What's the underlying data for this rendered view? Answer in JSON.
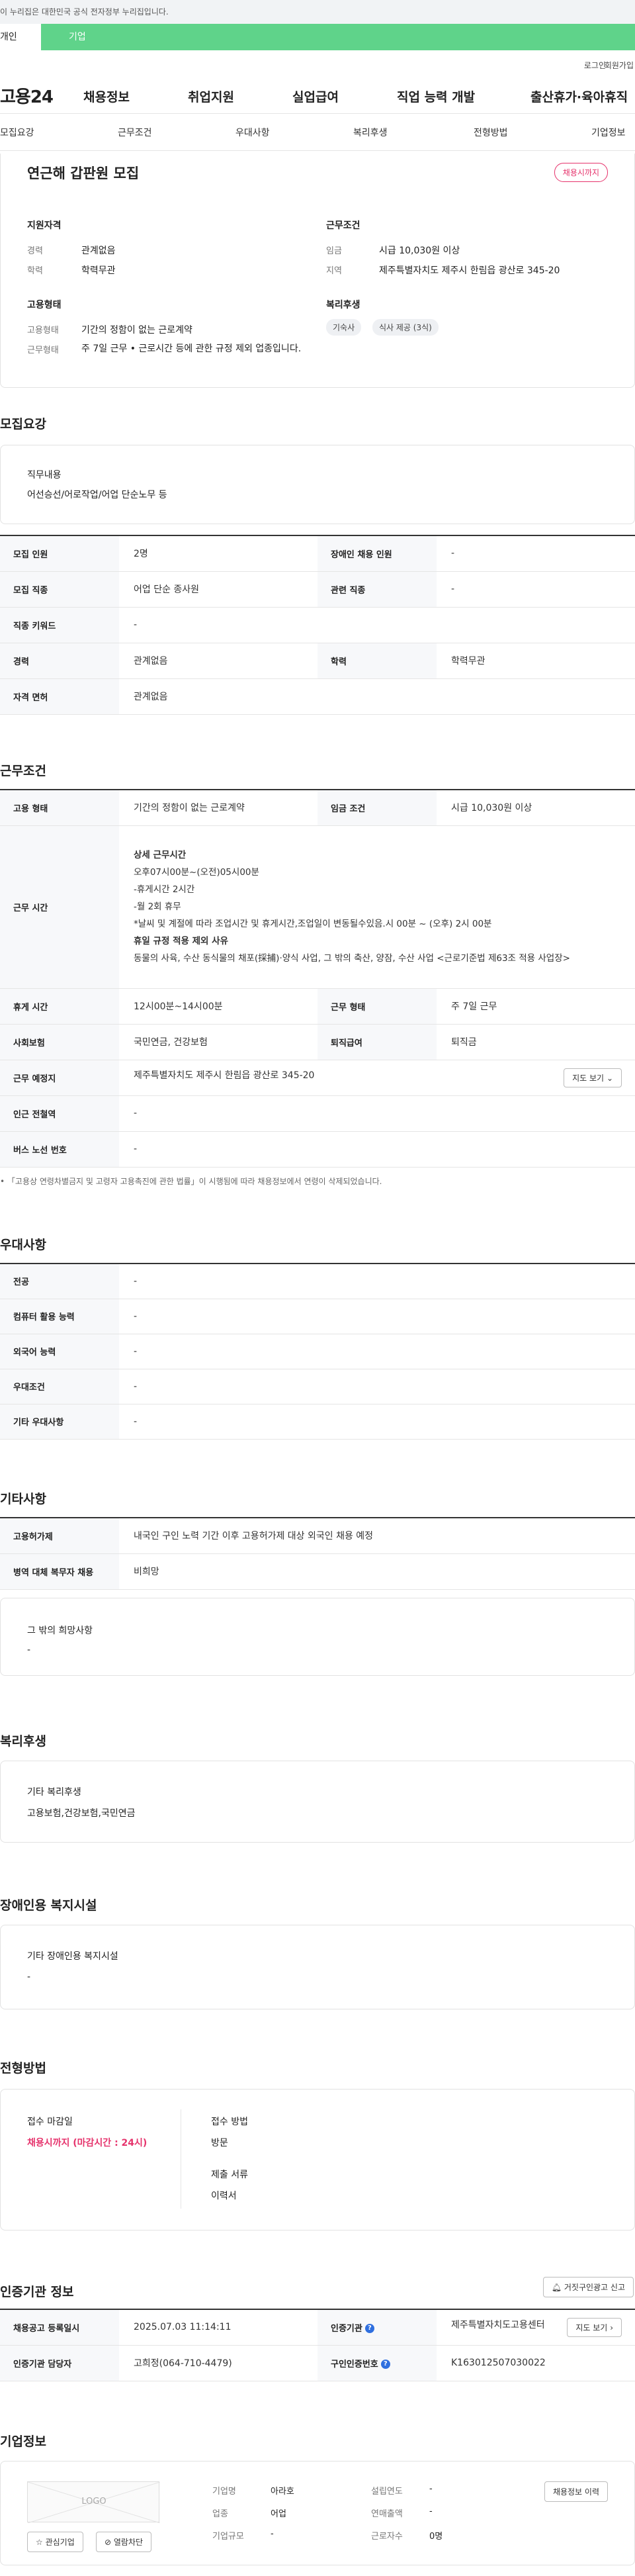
{
  "gov_bar": "이 누리집은 대한민국 공식 전자정부 누리집입니다.",
  "user_tabs": [
    "개인",
    "기업"
  ],
  "util": {
    "login": "로그인",
    "join": "회원가입"
  },
  "logo": "고용24",
  "gnb": [
    "채용정보",
    "취업지원",
    "실업급여",
    "직업 능력 개발",
    "출산휴가·육아휴직"
  ],
  "snb": [
    "모집요강",
    "근무조건",
    "우대사항",
    "복리후생",
    "전형방법",
    "기업정보"
  ],
  "summary": {
    "title": "연근해 갑판원 모집",
    "status": "채용시까지",
    "qual_head": "지원자격",
    "career_label": "경력",
    "career_value": "관계없음",
    "edu_label": "학력",
    "edu_value": "학력무관",
    "cond_head": "근무조건",
    "wage_label": "임금",
    "wage_value": "시급 10,030원 이상",
    "region_label": "지역",
    "region_value": "제주특별자치도 제주시 한림읍 광산로 345-20",
    "emp_head": "고용형태",
    "emptype_label": "고용형태",
    "emptype_value": "기간의 정함이 없는 근로계약",
    "worktype_label": "근무형태",
    "worktype_value": "주 7일 근무 • 근로시간 등에 관한 규정 제외 업종입니다.",
    "welfare_head": "복리후생",
    "chips": [
      "기숙사",
      "식사 제공 (3식)"
    ]
  },
  "recruit": {
    "title": "모집요강",
    "duty_head": "직무내용",
    "duty_value": "어선승선/어로작업/어업 단순노무 등",
    "rows": [
      [
        "모집 인원",
        "2명",
        "장애인 채용 인원",
        "-"
      ],
      [
        "모집 직종",
        "어업 단순 종사원",
        "관련 직종",
        "-"
      ],
      [
        "직종 키워드",
        "-"
      ],
      [
        "경력",
        "관계없음",
        "학력",
        "학력무관"
      ],
      [
        "자격 면허",
        "관계없음"
      ]
    ]
  },
  "work": {
    "title": "근무조건",
    "emptype_th": "고용 형태",
    "emptype_td": "기간의 정함이 없는 근로계약",
    "wage_th": "임금 조건",
    "wage_td": "시급 10,030원 이상",
    "hours_th": "근무 시간",
    "hours_lines": [
      "상세 근무시간",
      "오후07시00분~(오전)05시00분",
      "-휴게시간 2시간",
      "-월 2회 휴무",
      "*날씨 및 계절에 따라 조업시간 및 휴게시간,조업일이 변동될수있음.시 00분 ~ (오후) 2시 00분",
      "휴일 규정 적용 제외 사유",
      "동물의 사육, 수산 동식물의 채포(採捕)·양식 사업, 그 밖의 축산, 양잠, 수산 사업 <근로기준법 제63조 적용 사업장>"
    ],
    "break_th": "휴게 시간",
    "break_td": "12시00분~14시00분",
    "worktype_th": "근무 형태",
    "worktype_td": "주 7일 근무",
    "ins_th": "사회보험",
    "ins_td": "국민연금, 건강보험",
    "retire_th": "퇴직급여",
    "retire_td": "퇴직금",
    "place_th": "근무 예정지",
    "place_td": "제주특별자치도 제주시 한림읍 광산로 345-20",
    "map_btn": "지도 보기",
    "subway_th": "인근 전철역",
    "subway_td": "-",
    "bus_th": "버스 노선 번호",
    "bus_td": "-",
    "note": "「고용상 연령차별금지 및 고령자 고용촉진에 관한 법률」이 시행됨에 따라 채용정보에서 연령이 삭제되었습니다."
  },
  "pref": {
    "title": "우대사항",
    "rows": [
      [
        "전공",
        "-"
      ],
      [
        "컴퓨터 활용 능력",
        "-"
      ],
      [
        "외국어 능력",
        "-"
      ],
      [
        "우대조건",
        "-"
      ],
      [
        "기타 우대사항",
        "-"
      ]
    ]
  },
  "etc": {
    "title": "기타사항",
    "rows": [
      [
        "고용허가제",
        "내국인 구인 노력 기간 이후 고용허가제 대상 외국인 채용 예정"
      ],
      [
        "병역 대체 복무자 채용",
        "비희망"
      ]
    ],
    "wish_head": "그 밖의 희망사항",
    "wish_value": "-"
  },
  "welfare": {
    "title": "복리후생",
    "head": "기타 복리후생",
    "value": "고용보험,건강보험,국민연금"
  },
  "disabled": {
    "title": "장애인용 복지시설",
    "head": "기타 장애인용 복지시설",
    "value": "-"
  },
  "process": {
    "title": "전형방법",
    "deadline_head": "접수 마감일",
    "deadline_value": "채용시까지 (마감시간 : 24시)",
    "method_head": "접수 방법",
    "method_value": "방문",
    "docs_head": "제출 서류",
    "docs_value": "이력서"
  },
  "agency": {
    "title": "인증기관 정보",
    "report_btn": "거짓구인광고 신고",
    "reg_th": "채용공고 등록일시",
    "reg_td": "2025.07.03 11:14:11",
    "org_th": "인증기관",
    "org_td": "제주특별자치도고용센터",
    "map_btn": "지도 보기",
    "mgr_th": "인증기관 담당자",
    "mgr_td": "고희정(064-710-4479)",
    "no_th": "구인인증번호",
    "no_td": "K163012507030022"
  },
  "company": {
    "title": "기업정보",
    "logo_text": "LOGO",
    "interest_btn": "관심기업",
    "block_btn": "열람차단",
    "history_btn": "채용정보 이력",
    "name_l": "기업명",
    "name_v": "아라호",
    "found_l": "설립연도",
    "found_v": "-",
    "ind_l": "업종",
    "ind_v": "어업",
    "sales_l": "연매출액",
    "sales_v": "-",
    "size_l": "기업규모",
    "size_v": "-",
    "emp_l": "근로자수",
    "emp_v": "0명"
  }
}
